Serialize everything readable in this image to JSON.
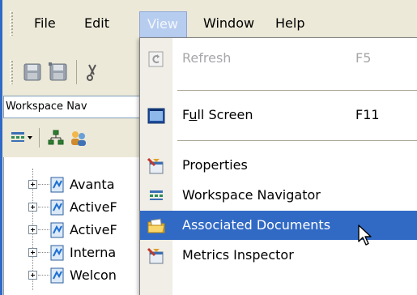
{
  "menubar": {
    "items": [
      {
        "label": "File"
      },
      {
        "label": "Edit"
      },
      {
        "label": "View"
      },
      {
        "label": "Window"
      },
      {
        "label": "Help"
      }
    ],
    "open_index": 2
  },
  "left_panel": {
    "header": "Workspace Nav",
    "tree": [
      {
        "label": "Avanta"
      },
      {
        "label": "ActiveF"
      },
      {
        "label": "ActiveF"
      },
      {
        "label": "Interna"
      },
      {
        "label": "Welcon"
      }
    ]
  },
  "view_menu": {
    "refresh": {
      "label": "Refresh",
      "shortcut": "F5",
      "icon": "refresh-icon",
      "enabled": false
    },
    "full_screen": {
      "label_pre": "F",
      "label_u": "u",
      "label_post": "ll Screen",
      "shortcut": "F11",
      "icon": "full-screen-icon"
    },
    "properties": {
      "label": "Properties",
      "icon": "properties-icon"
    },
    "workspace_navigator": {
      "label": "Workspace Navigator",
      "icon": "workspace-navigator-icon"
    },
    "associated_documents": {
      "label": "Associated Documents",
      "icon": "folder-documents-icon",
      "highlighted": true
    },
    "metrics_inspector": {
      "label": "Metrics Inspector",
      "icon": "metrics-inspector-icon"
    }
  },
  "colors": {
    "highlight": "#316ac5",
    "menu_open": "#b7cdf0",
    "chrome": "#ece9d8"
  }
}
